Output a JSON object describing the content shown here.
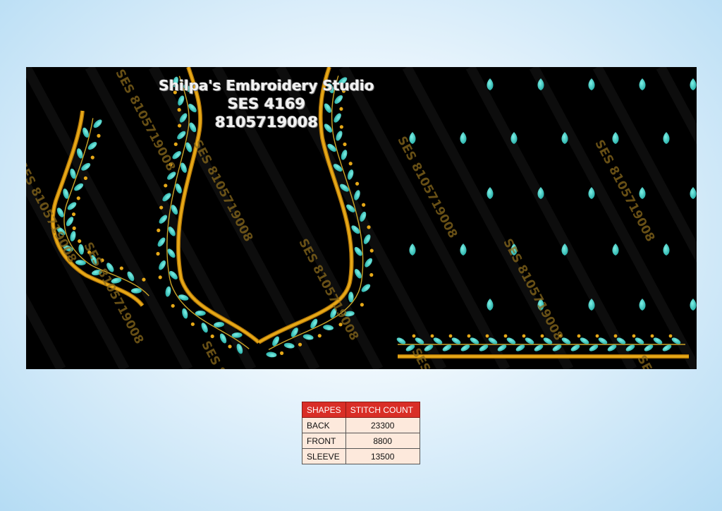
{
  "design": {
    "studio_name": "Shilpa's Embroidery Studio",
    "design_code": "SES 4169",
    "phone": "8105719008",
    "watermark": "SES 8105719008",
    "colors": {
      "background": "#000000",
      "gold": "#e6a817",
      "leaf": "#36c9c0"
    }
  },
  "table": {
    "headers": [
      "SHAPES",
      "STITCH COUNT"
    ],
    "rows": [
      {
        "shape": "BACK",
        "count": "23300"
      },
      {
        "shape": "FRONT",
        "count": "8800"
      },
      {
        "shape": "SLEEVE",
        "count": "13500"
      }
    ]
  }
}
